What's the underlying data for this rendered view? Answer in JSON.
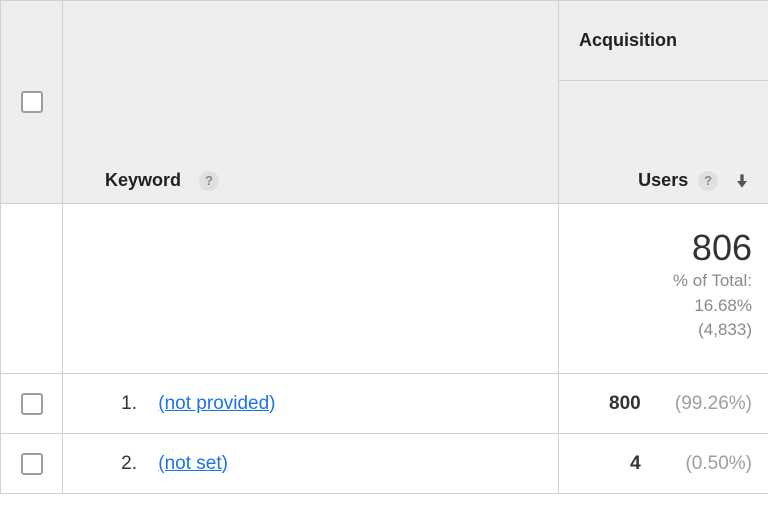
{
  "header": {
    "keyword_label": "Keyword",
    "acquisition_label": "Acquisition",
    "users_label": "Users"
  },
  "summary": {
    "users_total": "806",
    "pct_of_total_label": "% of Total:",
    "pct_of_total_value": "16.68%",
    "overall_count": "(4,833)"
  },
  "rows": [
    {
      "index": "1.",
      "keyword": "(not provided)",
      "users": "800",
      "pct": "(99.26%)"
    },
    {
      "index": "2.",
      "keyword": "(not set)",
      "users": "4",
      "pct": "(0.50%)"
    }
  ]
}
